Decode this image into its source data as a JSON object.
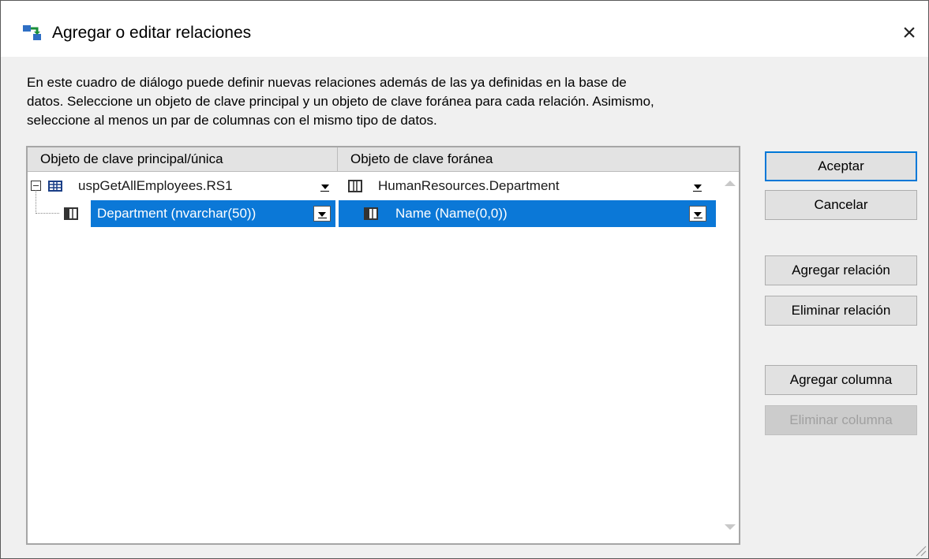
{
  "dialog": {
    "title": "Agregar o editar relaciones",
    "close_icon": "×",
    "description": "En este cuadro de diálogo puede definir nuevas relaciones además de las ya definidas en la base de\ndatos. Seleccione un objeto de clave principal y un objeto de clave foránea para cada relación. Asimismo,\nseleccione al menos un par de columnas con el mismo tipo de datos."
  },
  "grid": {
    "columns": [
      "Objeto de clave principal/única",
      "Objeto de clave foránea"
    ],
    "parent_row": {
      "primary": "uspGetAllEmployees.RS1",
      "foreign": "HumanResources.Department"
    },
    "child_row": {
      "primary": "Department (nvarchar(50))",
      "foreign": "Name (Name(0,0))"
    }
  },
  "buttons": {
    "ok": "Aceptar",
    "cancel": "Cancelar",
    "add_relation": "Agregar relación",
    "remove_relation": "Eliminar relación",
    "add_column": "Agregar columna",
    "remove_column": "Eliminar columna"
  },
  "colors": {
    "selection": "#0b78d7",
    "default_button_border": "#0078d7"
  },
  "icons": {
    "app": "relations-icon",
    "table": "table-icon",
    "column": "column-icon",
    "expander": "collapse-icon"
  }
}
